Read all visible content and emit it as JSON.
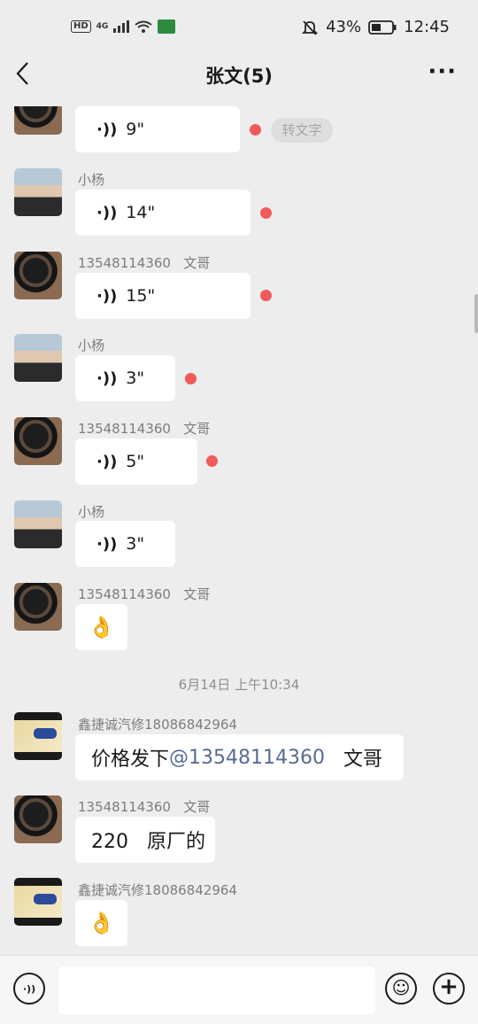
{
  "status_bar": {
    "hd": "HD",
    "network": "4G",
    "battery_percent": "43%",
    "time": "12:45"
  },
  "header": {
    "title": "张文(5)",
    "more": "···"
  },
  "messages": [
    {
      "sender": "",
      "type": "voice",
      "duration": "9\"",
      "unread": true,
      "convert_label": "转文字"
    },
    {
      "sender": "小杨",
      "type": "voice",
      "duration": "14\"",
      "unread": true
    },
    {
      "sender": "13548114360   文哥",
      "type": "voice",
      "duration": "15\"",
      "unread": true
    },
    {
      "sender": "小杨",
      "type": "voice",
      "duration": "3\"",
      "unread": true
    },
    {
      "sender": "13548114360   文哥",
      "type": "voice",
      "duration": "5\"",
      "unread": true
    },
    {
      "sender": "小杨",
      "type": "voice",
      "duration": "3\"",
      "unread": false
    },
    {
      "sender": "13548114360   文哥",
      "type": "emoji",
      "content": "👌"
    },
    {
      "timestamp": "6月14日 上午10:34"
    },
    {
      "sender": "鑫捷诚汽修18086842964",
      "type": "text",
      "prefix": "价格发下",
      "mention": "@13548114360",
      "suffix": "   文哥"
    },
    {
      "sender": "13548114360   文哥",
      "type": "text",
      "content": "220   原厂的"
    },
    {
      "sender": "鑫捷诚汽修18086842964",
      "type": "emoji",
      "content": "👌"
    }
  ],
  "input_bar": {
    "voice_icon": "voice-toggle-icon",
    "emoji_icon": "emoji-icon",
    "plus_icon": "plus-icon",
    "placeholder": ""
  },
  "voice_wave_glyph": "·))",
  "emoji_face": "☺",
  "plus_glyph": "+"
}
